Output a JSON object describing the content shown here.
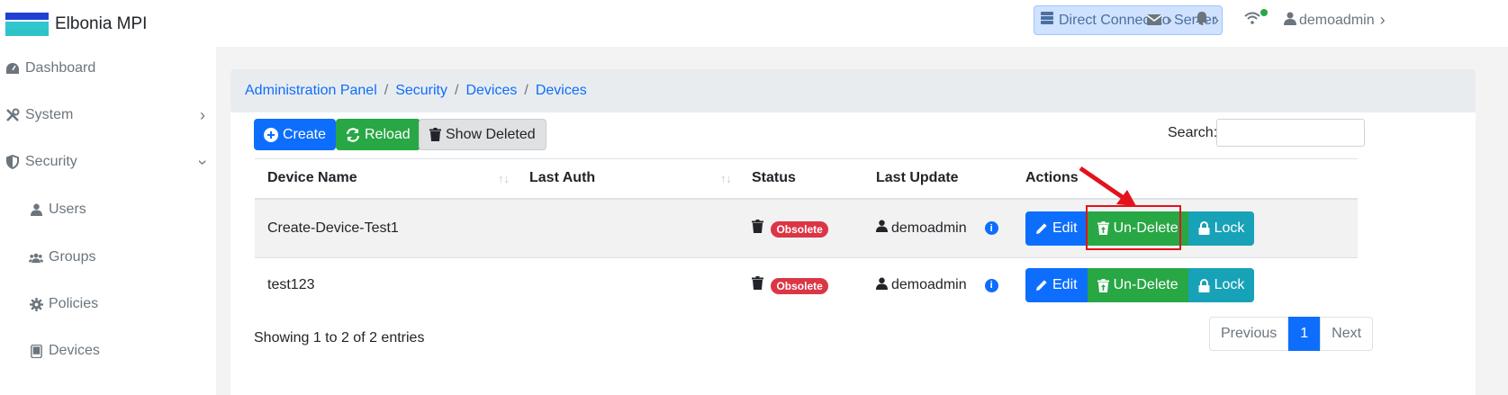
{
  "app": {
    "title": "Elbonia MPI"
  },
  "topbar": {
    "direct_connect": "Direct Connect to Server",
    "user": "demoadmin"
  },
  "sidebar": {
    "items": [
      {
        "label": "Dashboard",
        "icon": "dashboard-icon"
      },
      {
        "label": "System",
        "icon": "tools-icon"
      },
      {
        "label": "Security",
        "icon": "shield-icon"
      },
      {
        "label": "Users",
        "icon": "user-icon"
      },
      {
        "label": "Groups",
        "icon": "users-icon"
      },
      {
        "label": "Policies",
        "icon": "gear-icon"
      },
      {
        "label": "Devices",
        "icon": "tablet-icon"
      }
    ]
  },
  "breadcrumb": [
    "Administration Panel",
    "Security",
    "Devices",
    "Devices"
  ],
  "toolbar": {
    "create": "Create",
    "reload": "Reload",
    "show_deleted": "Show Deleted",
    "search_label": "Search:"
  },
  "table": {
    "headers": [
      "Device Name",
      "Last Auth",
      "Status",
      "Last Update",
      "Actions"
    ],
    "rows": [
      {
        "name": "Create-Device-Test1",
        "last_auth": "",
        "status": "Obsolete",
        "updated_by": "demoadmin"
      },
      {
        "name": "test123",
        "last_auth": "",
        "status": "Obsolete",
        "updated_by": "demoadmin"
      }
    ],
    "actions": {
      "edit": "Edit",
      "undelete": "Un-Delete",
      "lock": "Lock"
    }
  },
  "footer": {
    "entries": "Showing 1 to 2 of 2 entries",
    "previous": "Previous",
    "page": "1",
    "next": "Next"
  },
  "colors": {
    "primary": "#0d6efd",
    "success": "#28a745",
    "info": "#17a2b8",
    "danger": "#dc3545",
    "annotation": "#e3121b"
  }
}
